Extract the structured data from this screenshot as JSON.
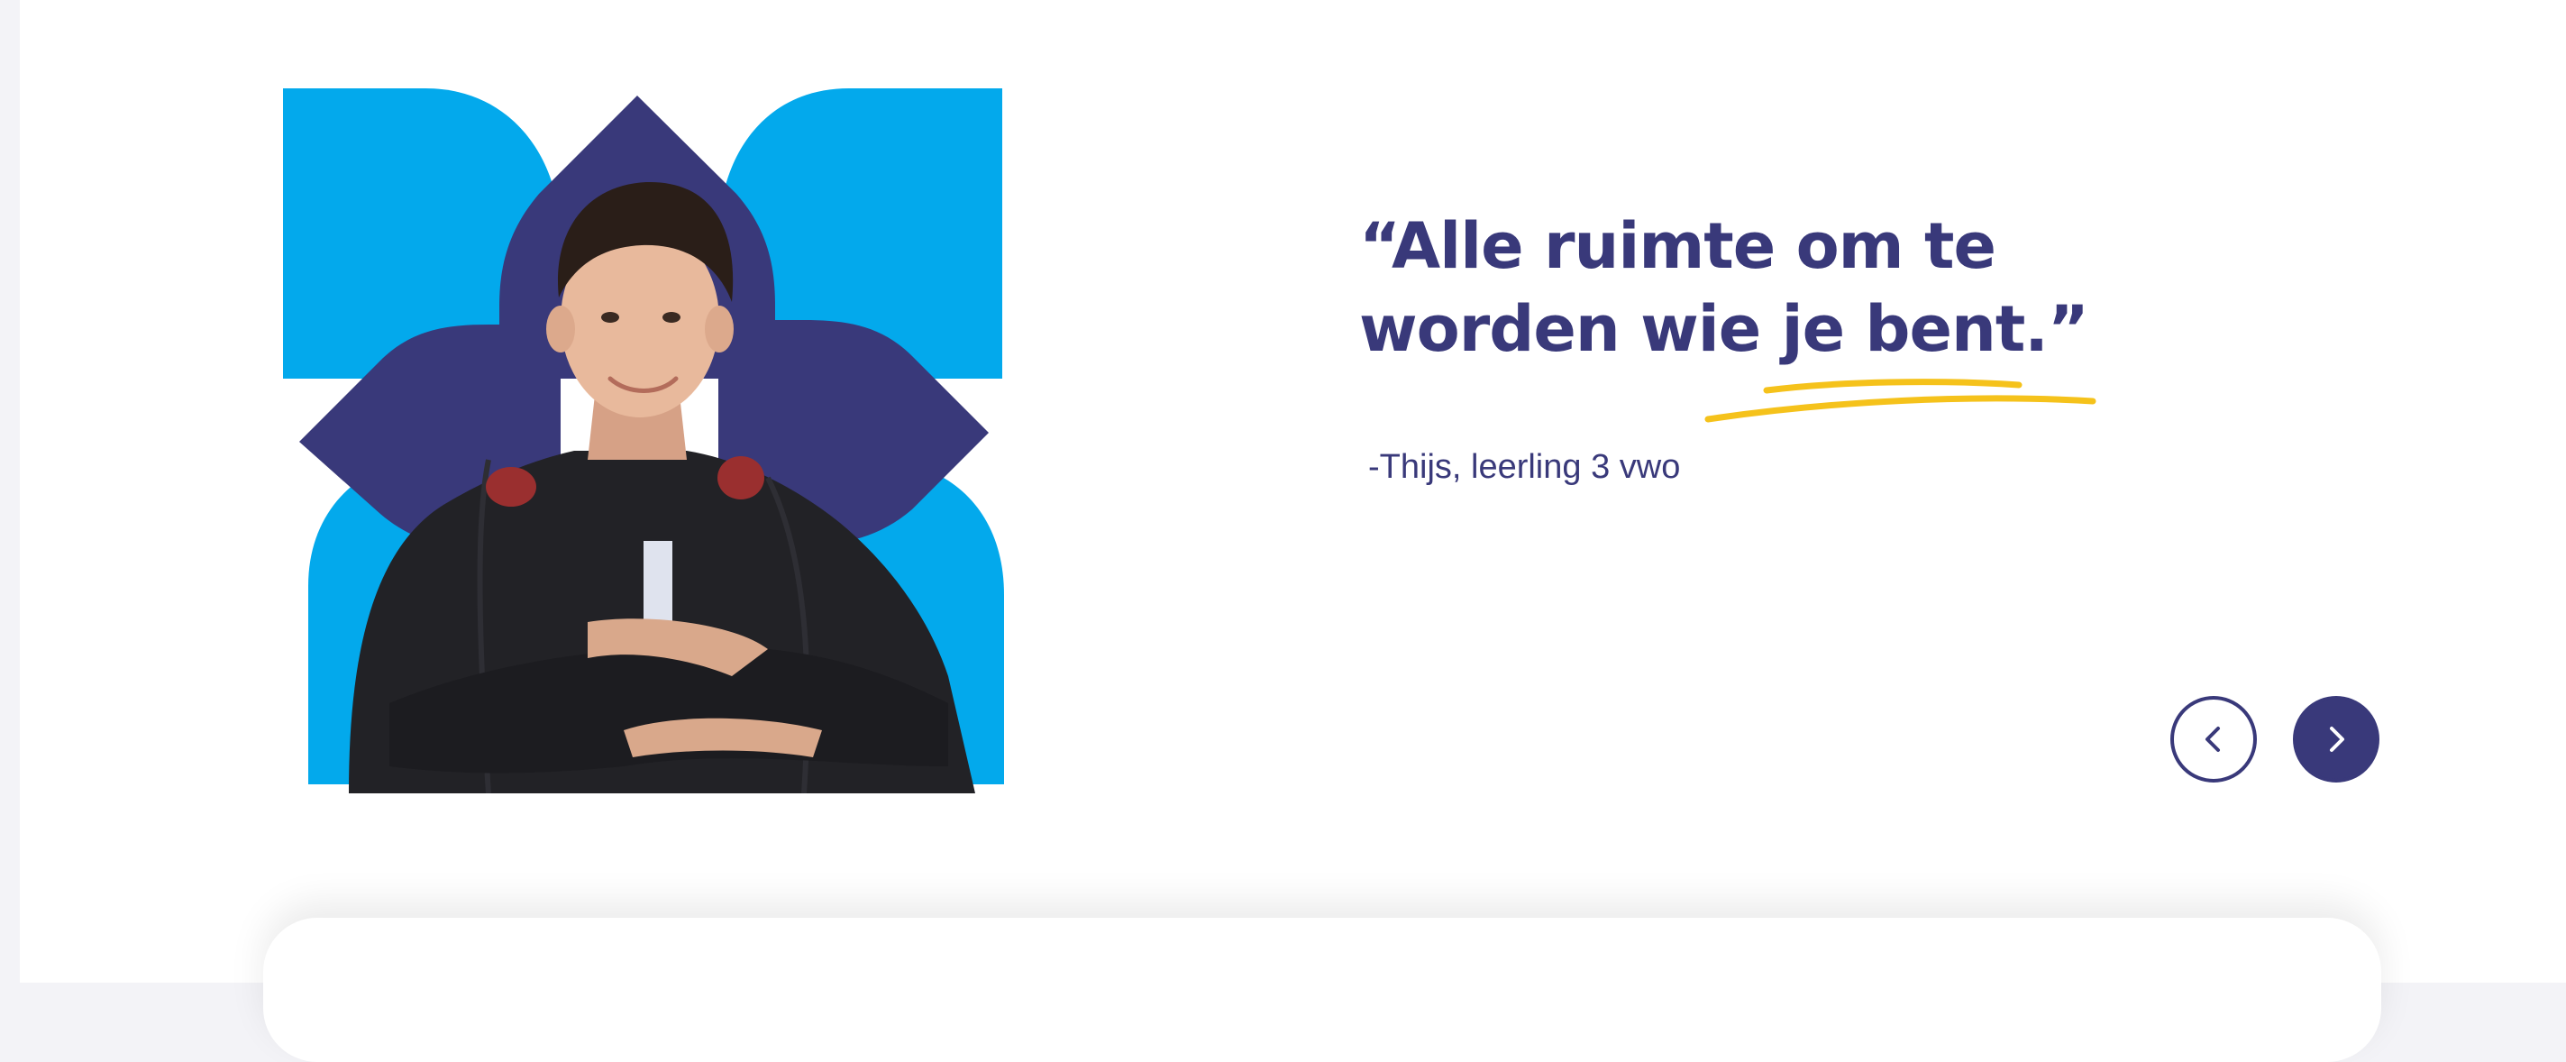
{
  "testimonial": {
    "quote_line1": "“Alle ruimte om te",
    "quote_line2": "worden wie je bent.”",
    "attribution": "-Thijs, leerling 3 vwo"
  },
  "colors": {
    "navy": "#39397a",
    "sky_blue": "#03a9ec",
    "accent_yellow": "#f5c21b",
    "background": "#ffffff"
  },
  "icons": {
    "prev": "chevron-left-icon",
    "next": "chevron-right-icon"
  }
}
